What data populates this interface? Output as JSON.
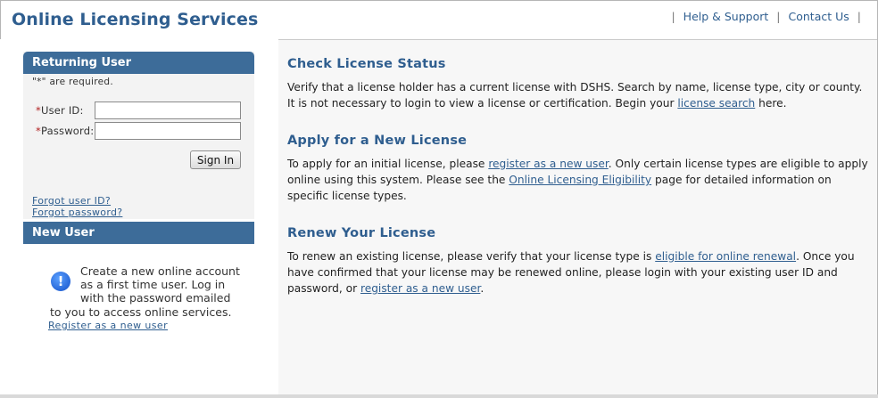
{
  "header": {
    "title": "Online Licensing Services",
    "links": [
      "Help & Support",
      "Contact Us"
    ]
  },
  "returning_user": {
    "title": "Returning User",
    "required_note": "\"*\" are required.",
    "user_id_label": "User ID:",
    "password_label": "Password:",
    "required_marker": "*",
    "user_id_value": "",
    "password_value": "",
    "sign_in_label": "Sign In",
    "forgot_user_id": "Forgot user ID?",
    "forgot_password": "Forgot password?"
  },
  "new_user": {
    "title": "New User",
    "text_lines": [
      "Create a new online account",
      "as a first time user. Log in",
      "with the password emailed",
      "to you to access online services."
    ],
    "register_link": "Register as a new user",
    "icon": "info-icon"
  },
  "main": {
    "check_status": {
      "heading": "Check License Status",
      "text_before": "Verify that a license holder has a current license with DSHS. Search by name, license type, city or county. It is not necessary to login to view a license or certification. Begin your ",
      "link": "license search",
      "text_after": " here."
    },
    "apply": {
      "heading": "Apply for a New License",
      "text_1": "To apply for an initial license, please ",
      "link_1": "register as a new user",
      "text_2": ". Only certain license types are eligible to apply online using this system. Please see the ",
      "link_2": "Online Licensing Eligibility",
      "text_3": " page for detailed information on specific license types."
    },
    "renew": {
      "heading": "Renew Your License",
      "text_1": "To renew an existing license, please verify that your license type is ",
      "link_1": "eligible for online renewal",
      "text_2": ". Once you have confirmed that your license may be renewed online, please login with your existing user ID and password, or ",
      "link_2": "register as a new user",
      "text_3": "."
    }
  },
  "colors": {
    "brand": "#2f5e8f",
    "panel_header": "#3d6c99",
    "required": "#b22222"
  }
}
